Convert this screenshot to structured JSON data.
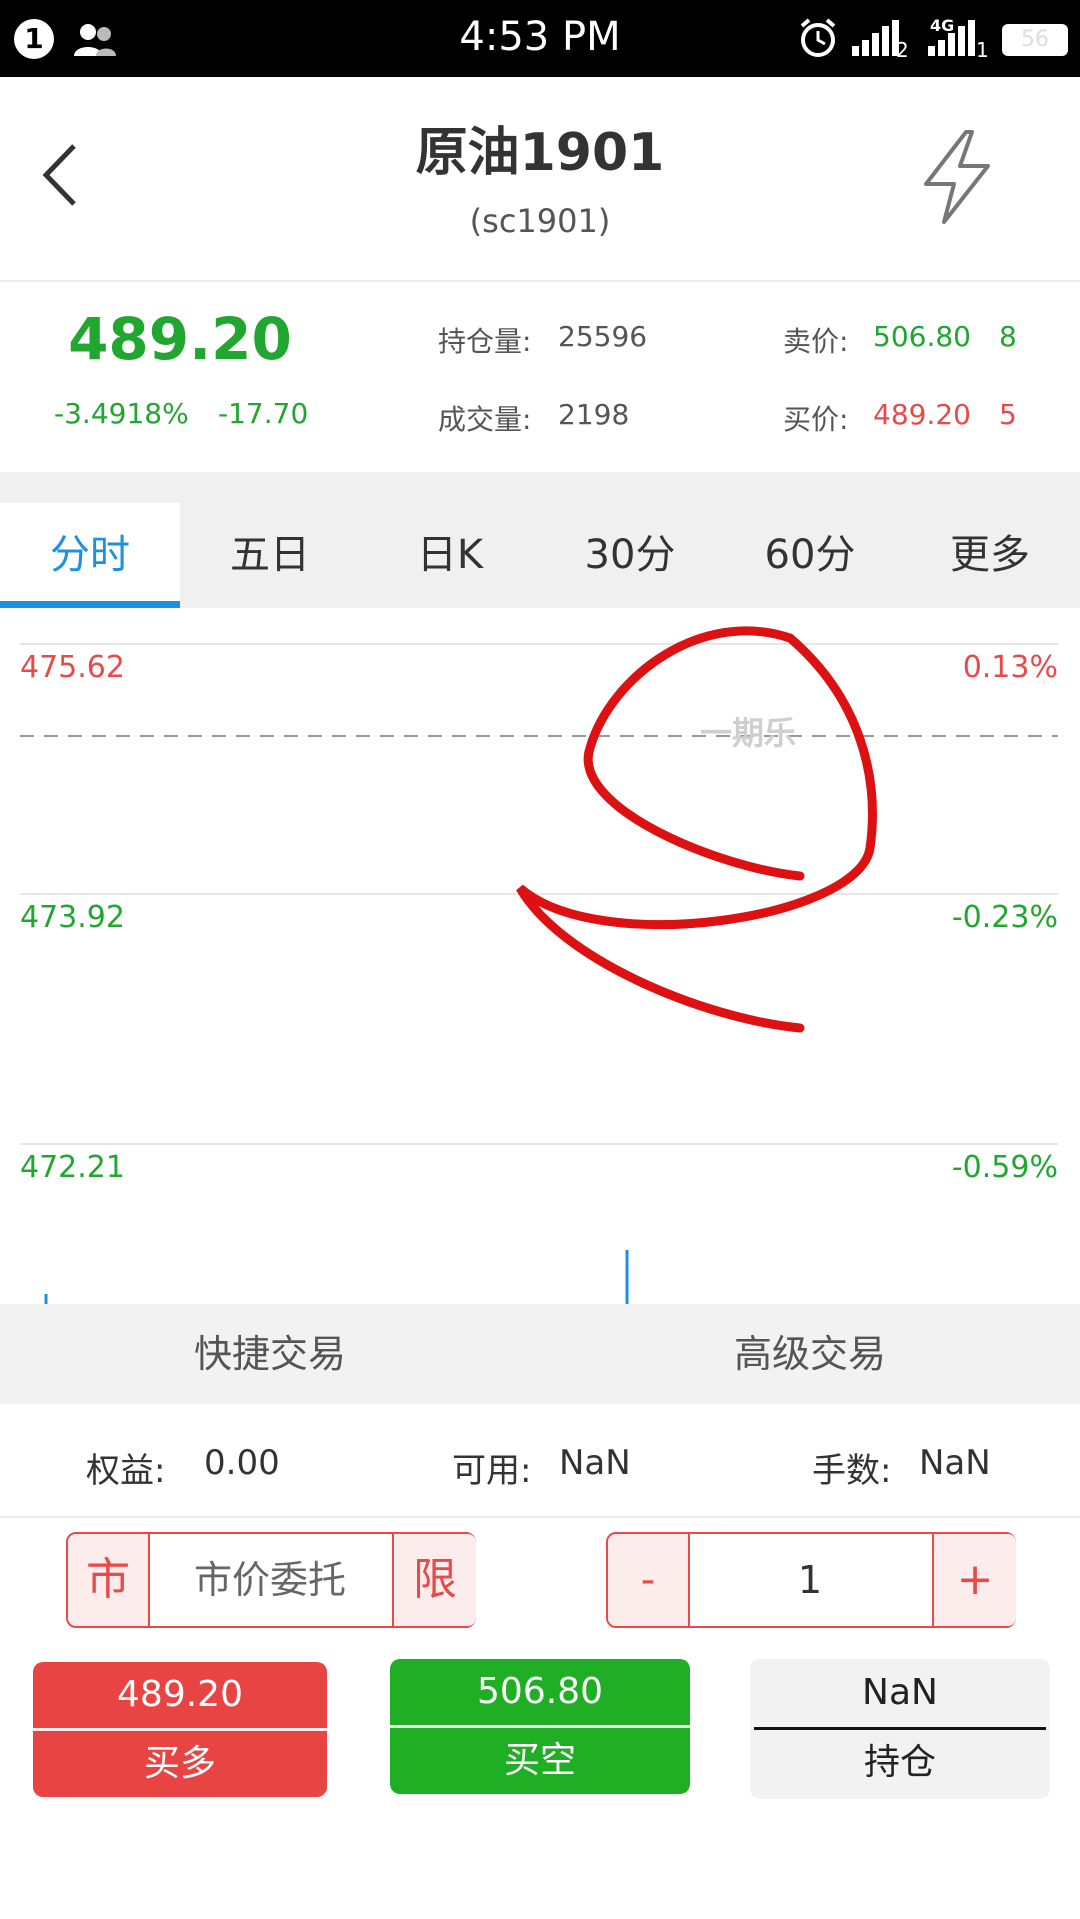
{
  "status_bar": {
    "notification_count": "1",
    "time": "4:53 PM",
    "network_label": "4G",
    "sim1": "2",
    "sim2": "1",
    "battery": "56"
  },
  "header": {
    "title": "原油1901",
    "subtitle": "(sc1901)"
  },
  "quote": {
    "last_price": "489.20",
    "change_pct": "-3.4918%",
    "change": "-17.70",
    "open_interest_label": "持仓量:",
    "open_interest": "25596",
    "volume_label": "成交量:",
    "volume": "2198",
    "ask_label": "卖价:",
    "ask_price": "506.80",
    "ask_size": "8",
    "bid_label": "买价:",
    "bid_price": "489.20",
    "bid_size": "5"
  },
  "tabs": [
    "分时",
    "五日",
    "日K",
    "30分",
    "60分",
    "更多"
  ],
  "active_tab": 0,
  "chart": {
    "left_labels": [
      "475.62",
      "473.92",
      "472.21"
    ],
    "right_labels": [
      "0.13%",
      "-0.23%",
      "-0.59%"
    ],
    "watermark": "一期乐"
  },
  "trade_tabs": [
    "快捷交易",
    "高级交易"
  ],
  "account": {
    "equity_label": "权益:",
    "equity": "0.00",
    "available_label": "可用:",
    "available": "NaN",
    "lots_label": "手数:",
    "lots": "NaN"
  },
  "order": {
    "market_tag": "市",
    "order_type": "市价委托",
    "limit_tag": "限",
    "minus": "-",
    "quantity": "1",
    "plus": "+"
  },
  "actions": {
    "buy_long_price": "489.20",
    "buy_long_label": "买多",
    "sell_short_price": "506.80",
    "sell_short_label": "买空",
    "position_value": "NaN",
    "position_label": "持仓"
  },
  "colors": {
    "green": "#21a630",
    "red": "#e84a4a",
    "blue": "#1e90e0",
    "buy_button": "#e84444",
    "sell_button": "#1fae24"
  }
}
